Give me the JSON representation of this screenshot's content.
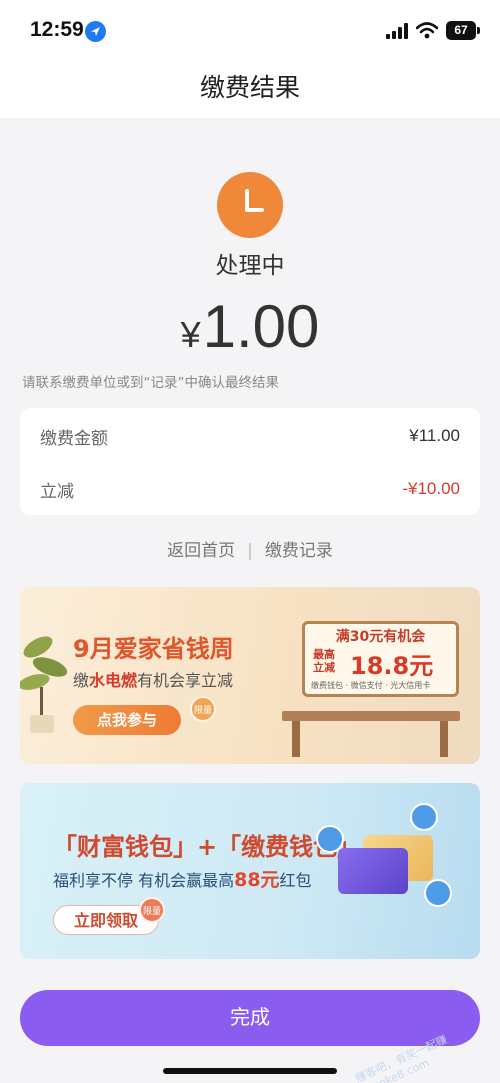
{
  "status_bar": {
    "time": "12:59",
    "battery": "67"
  },
  "nav": {
    "title": "缴费结果"
  },
  "result": {
    "status": "处理中",
    "currency": "¥",
    "amount": "1.00",
    "hint": "请联系缴费单位或到“记录”中确认最终结果"
  },
  "details": [
    {
      "label": "缴费金额",
      "value": "¥11.00"
    },
    {
      "label": "立减",
      "value": "-¥10.00"
    }
  ],
  "links": {
    "home": "返回首页",
    "records": "缴费记录"
  },
  "banner1": {
    "title": "9月爱家省钱周",
    "sub_pre": "缴",
    "sub_hl": "水电燃",
    "sub_post": "有机会享立减",
    "cta": "点我参与",
    "limit": "限量",
    "board_title": "满30元有机会",
    "board_small": "最高立减",
    "board_amount": "18.8元",
    "board_foot": "缴费钱包 · 微信支付 · 光大信用卡"
  },
  "banner2": {
    "title": "「财富钱包」+「缴费钱包」",
    "sub_pre": "福利享不停 有机会赢最高",
    "sub_hl": "88元",
    "sub_post": "红包",
    "cta": "立即领取",
    "limit": "限量"
  },
  "done_label": "完成",
  "watermark": "赚客吧，有奖一起赚 zuanke8.com",
  "colors": {
    "accent_purple": "#8b5cf0",
    "status_orange": "#f0883a",
    "discount_red": "#d43b2f"
  }
}
